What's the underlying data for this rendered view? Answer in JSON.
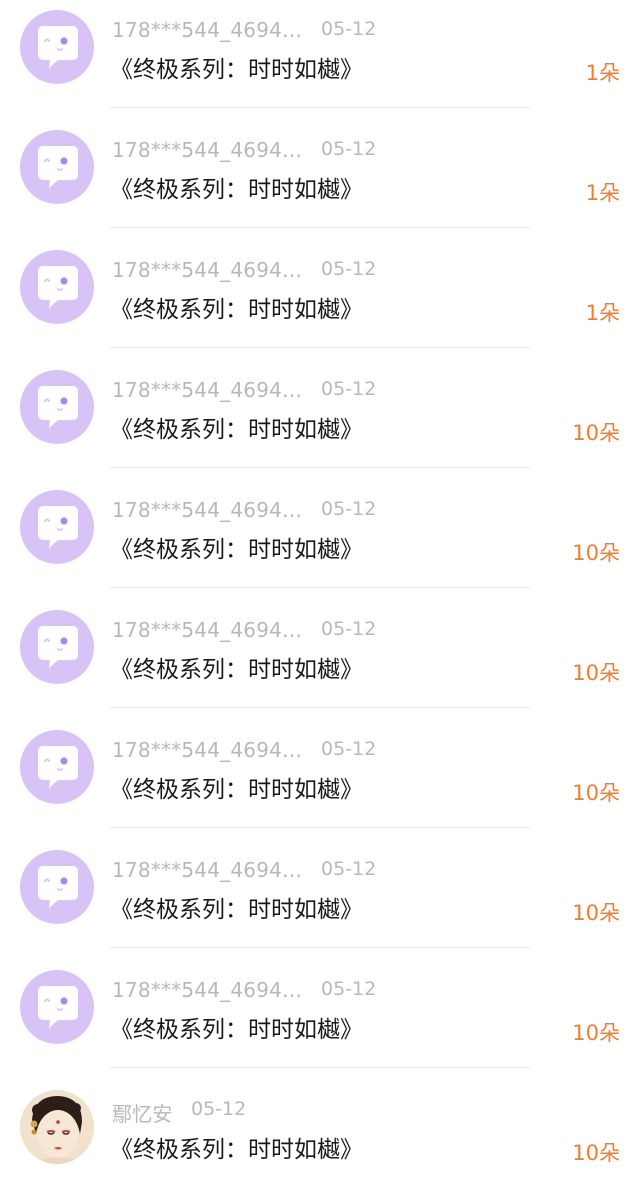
{
  "gift_list": {
    "items": [
      {
        "user": "178***544_4694…",
        "date": "05-12",
        "title": "《终极系列：时时如樾》",
        "amount": "1朵",
        "avatar": "chat-bubble-avatar"
      },
      {
        "user": "178***544_4694…",
        "date": "05-12",
        "title": "《终极系列：时时如樾》",
        "amount": "1朵",
        "avatar": "chat-bubble-avatar"
      },
      {
        "user": "178***544_4694…",
        "date": "05-12",
        "title": "《终极系列：时时如樾》",
        "amount": "1朵",
        "avatar": "chat-bubble-avatar"
      },
      {
        "user": "178***544_4694…",
        "date": "05-12",
        "title": "《终极系列：时时如樾》",
        "amount": "10朵",
        "avatar": "chat-bubble-avatar"
      },
      {
        "user": "178***544_4694…",
        "date": "05-12",
        "title": "《终极系列：时时如樾》",
        "amount": "10朵",
        "avatar": "chat-bubble-avatar"
      },
      {
        "user": "178***544_4694…",
        "date": "05-12",
        "title": "《终极系列：时时如樾》",
        "amount": "10朵",
        "avatar": "chat-bubble-avatar"
      },
      {
        "user": "178***544_4694…",
        "date": "05-12",
        "title": "《终极系列：时时如樾》",
        "amount": "10朵",
        "avatar": "chat-bubble-avatar"
      },
      {
        "user": "178***544_4694…",
        "date": "05-12",
        "title": "《终极系列：时时如樾》",
        "amount": "10朵",
        "avatar": "chat-bubble-avatar"
      },
      {
        "user": "178***544_4694…",
        "date": "05-12",
        "title": "《终极系列：时时如樾》",
        "amount": "10朵",
        "avatar": "chat-bubble-avatar"
      },
      {
        "user": "鄢忆安",
        "date": "05-12",
        "title": "《终极系列：时时如樾》",
        "amount": "10朵",
        "avatar": "user-photo-avatar"
      }
    ]
  },
  "colors": {
    "avatar_bg": "#d7c3f6",
    "amount": "#f47c2c",
    "meta_text": "#b8b8b8",
    "title_text": "#1a1a1a"
  }
}
